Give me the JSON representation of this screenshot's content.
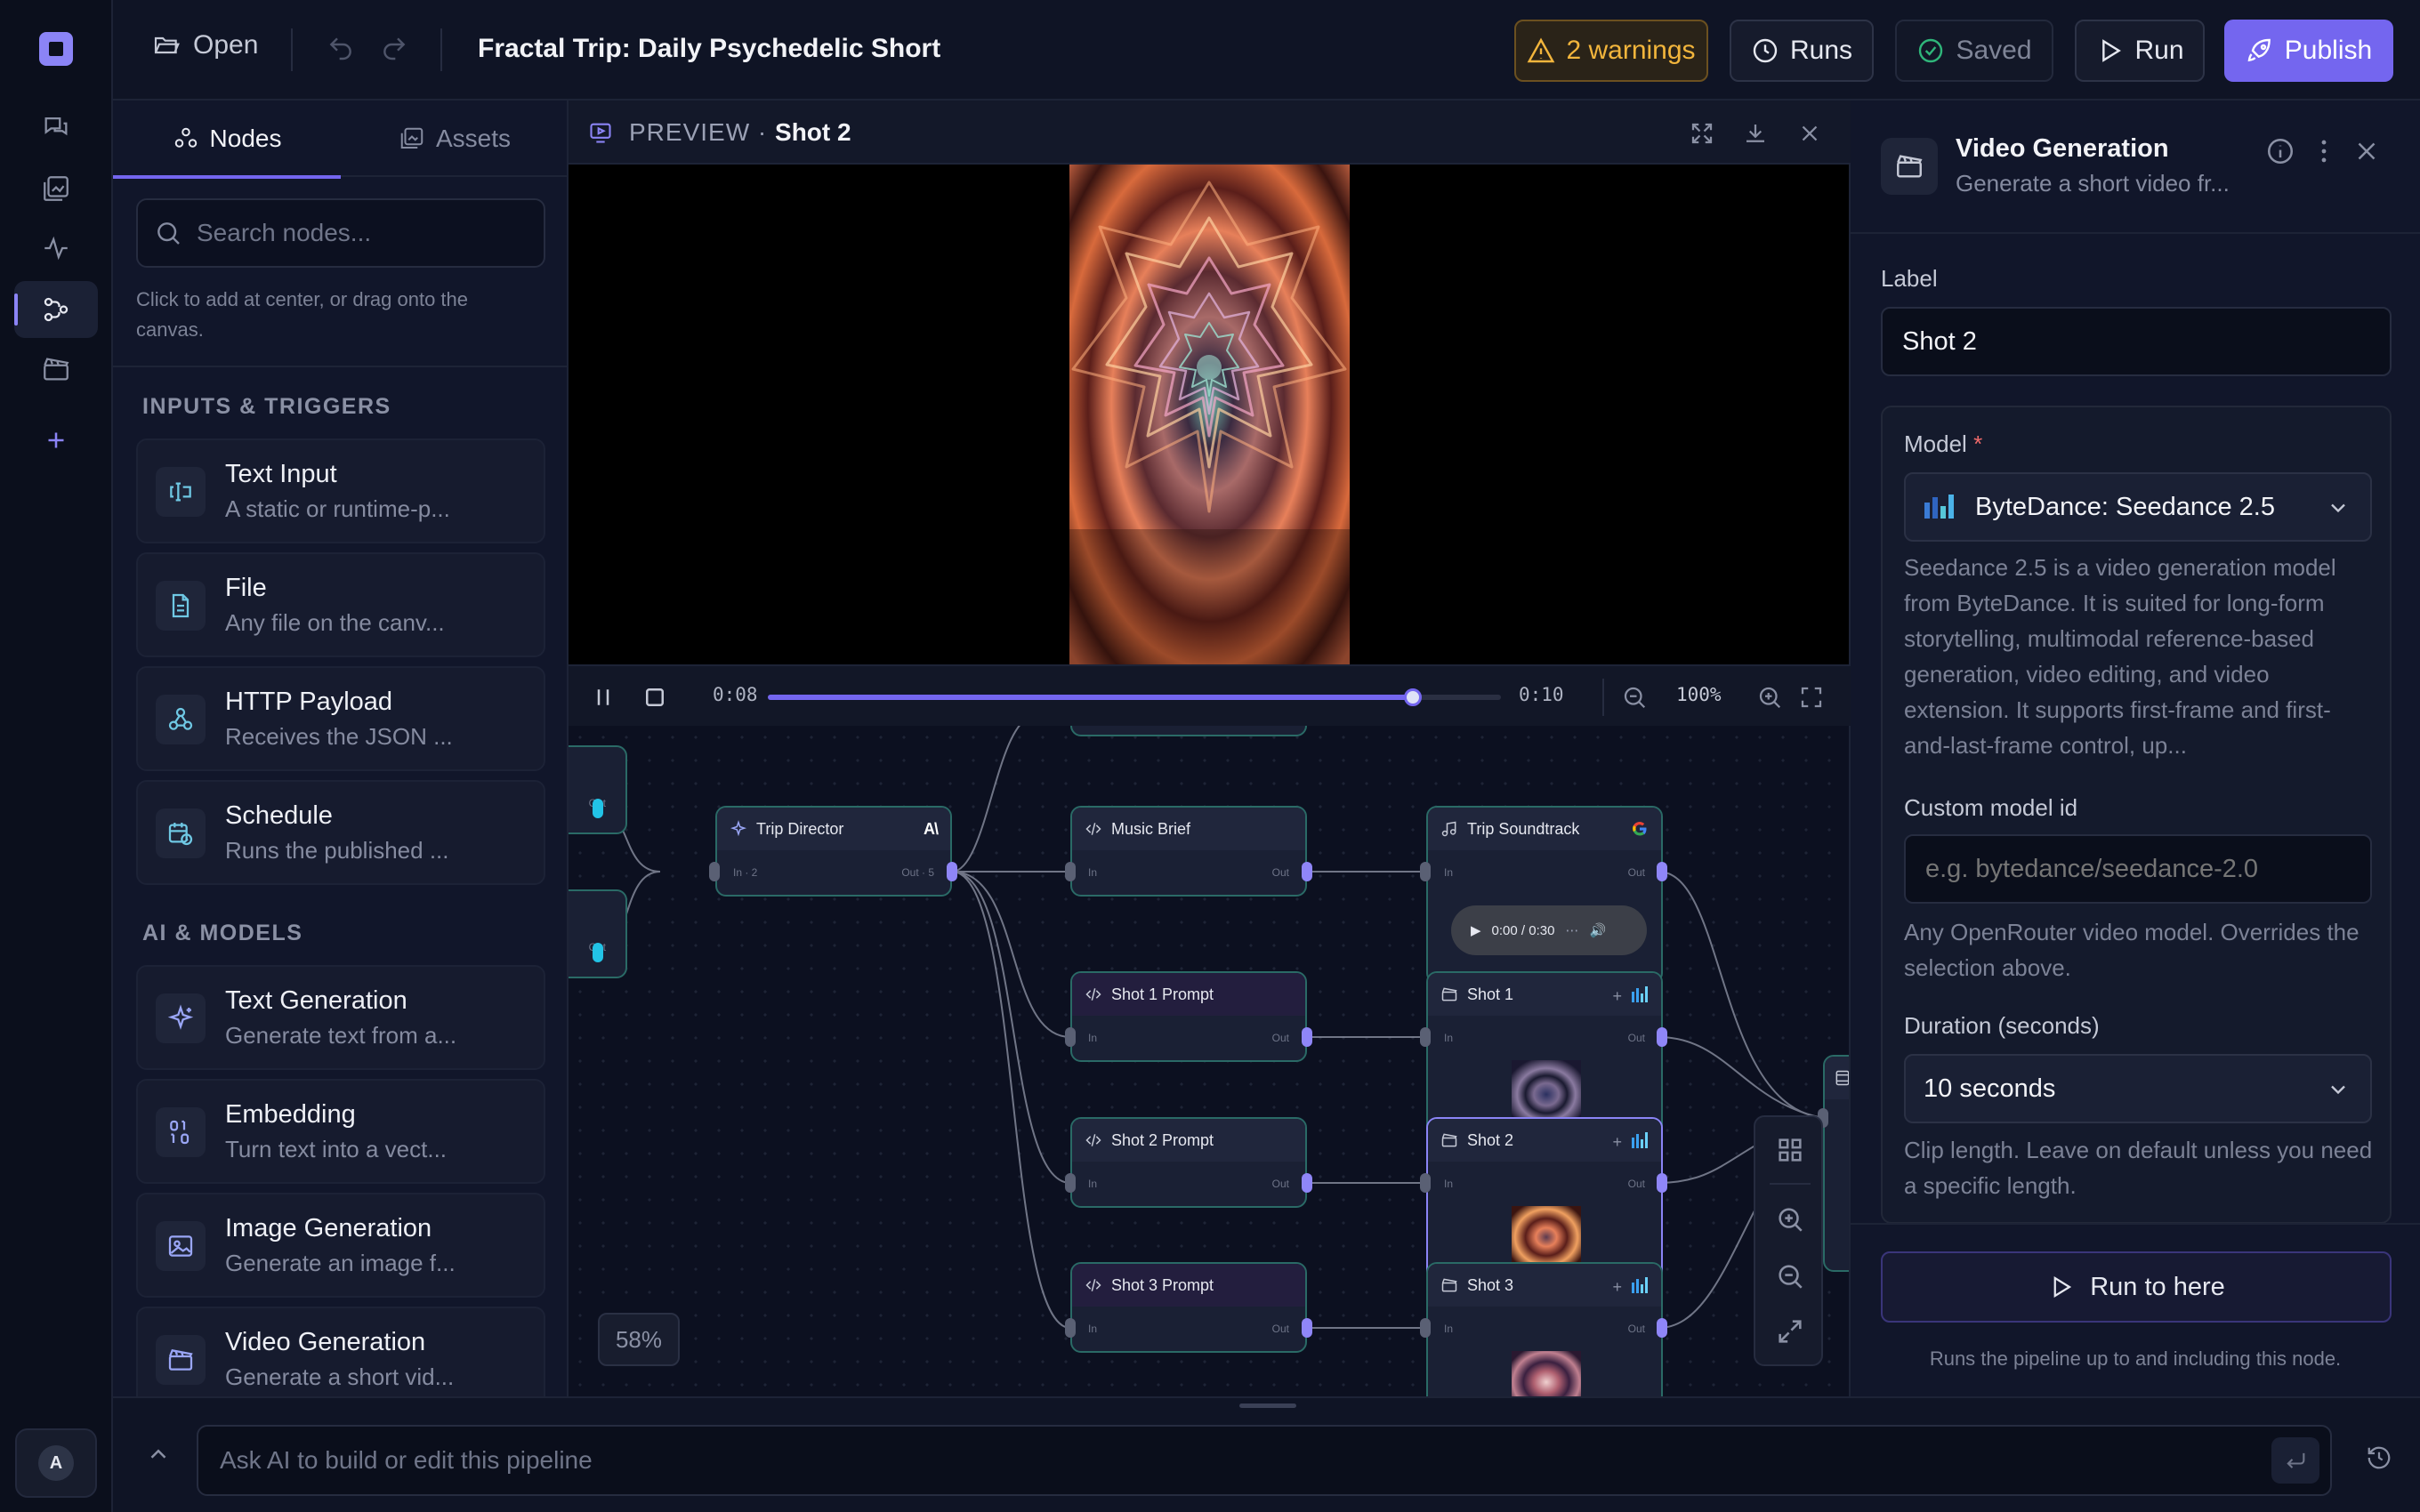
{
  "topbar": {
    "open_label": "Open",
    "title": "Fractal Trip: Daily Psychedelic Short",
    "warnings_label": "2 warnings",
    "runs_label": "Runs",
    "saved_label": "Saved",
    "run_label": "Run",
    "publish_label": "Publish"
  },
  "left_panel": {
    "tabs": [
      {
        "label": "Nodes",
        "active": true
      },
      {
        "label": "Assets",
        "active": false
      }
    ],
    "search_placeholder": "Search nodes...",
    "hint": "Click to add at center, or drag onto the canvas.",
    "sections": [
      {
        "title": "INPUTS & TRIGGERS",
        "items": [
          {
            "title": "Text Input",
            "desc": "A static or runtime-p...",
            "icon": "text-input-icon"
          },
          {
            "title": "File",
            "desc": "Any file on the canv...",
            "icon": "file-icon"
          },
          {
            "title": "HTTP Payload",
            "desc": "Receives the JSON ...",
            "icon": "webhook-icon"
          },
          {
            "title": "Schedule",
            "desc": "Runs the published ...",
            "icon": "calendar-clock-icon"
          }
        ]
      },
      {
        "title": "AI & MODELS",
        "items": [
          {
            "title": "Text Generation",
            "desc": "Generate text from a...",
            "icon": "sparkles-icon"
          },
          {
            "title": "Embedding",
            "desc": "Turn text into a vect...",
            "icon": "binary-icon"
          },
          {
            "title": "Image Generation",
            "desc": "Generate an image f...",
            "icon": "image-icon"
          },
          {
            "title": "Video Generation",
            "desc": "Generate a short vid...",
            "icon": "clapperboard-icon"
          }
        ]
      }
    ]
  },
  "preview": {
    "prefix": "PREVIEW",
    "separator": "·",
    "shot": "Shot 2",
    "current_time": "0:08",
    "duration": "0:10",
    "progress": 0.88,
    "zoom": "100%"
  },
  "canvas": {
    "zoom_label": "58%",
    "io": {
      "in": "In",
      "out": "Out",
      "in_n": "In · 2",
      "out_n": "Out · 5"
    },
    "nodes": {
      "trip_director": "Trip Director",
      "music_brief": "Music Brief",
      "trip_soundtrack": "Trip Soundtrack",
      "shot1_prompt": "Shot 1 Prompt",
      "shot2_prompt": "Shot 2 Prompt",
      "shot3_prompt": "Shot 3 Prompt",
      "shot1": "Shot 1",
      "shot2": "Shot 2",
      "shot3": "Shot 3"
    },
    "audio_time": "0:00 / 0:30"
  },
  "right_panel": {
    "title": "Video Generation",
    "desc": "Generate a short video fr...",
    "label_caption": "Label",
    "label_value": "Shot 2",
    "model_caption": "Model",
    "required_mark": "*",
    "model_value": "ByteDance: Seedance 2.5",
    "model_desc": "Seedance 2.5 is a video generation model from ByteDance. It is suited for long-form storytelling, multimodal reference-based generation, video editing, and video extension. It supports first-frame and first-and-last-frame control, up...",
    "custom_caption": "Custom model id",
    "custom_placeholder": "e.g. bytedance/seedance-2.0",
    "custom_help": "Any OpenRouter video model. Overrides the selection above.",
    "duration_caption": "Duration (seconds)",
    "duration_value": "10 seconds",
    "duration_help": "Clip length. Leave on default unless you need a specific length.",
    "run_here_label": "Run to here",
    "run_here_note": "Runs the pipeline up to and including this node."
  },
  "ai_bar": {
    "placeholder": "Ask AI to build or edit this pipeline"
  },
  "user": {
    "avatar_initial": "A"
  },
  "colors": {
    "accent": "#7466ef",
    "warning": "#f2b53c",
    "node_border": "#2a6a66",
    "port_cyan": "#22c3e6"
  }
}
